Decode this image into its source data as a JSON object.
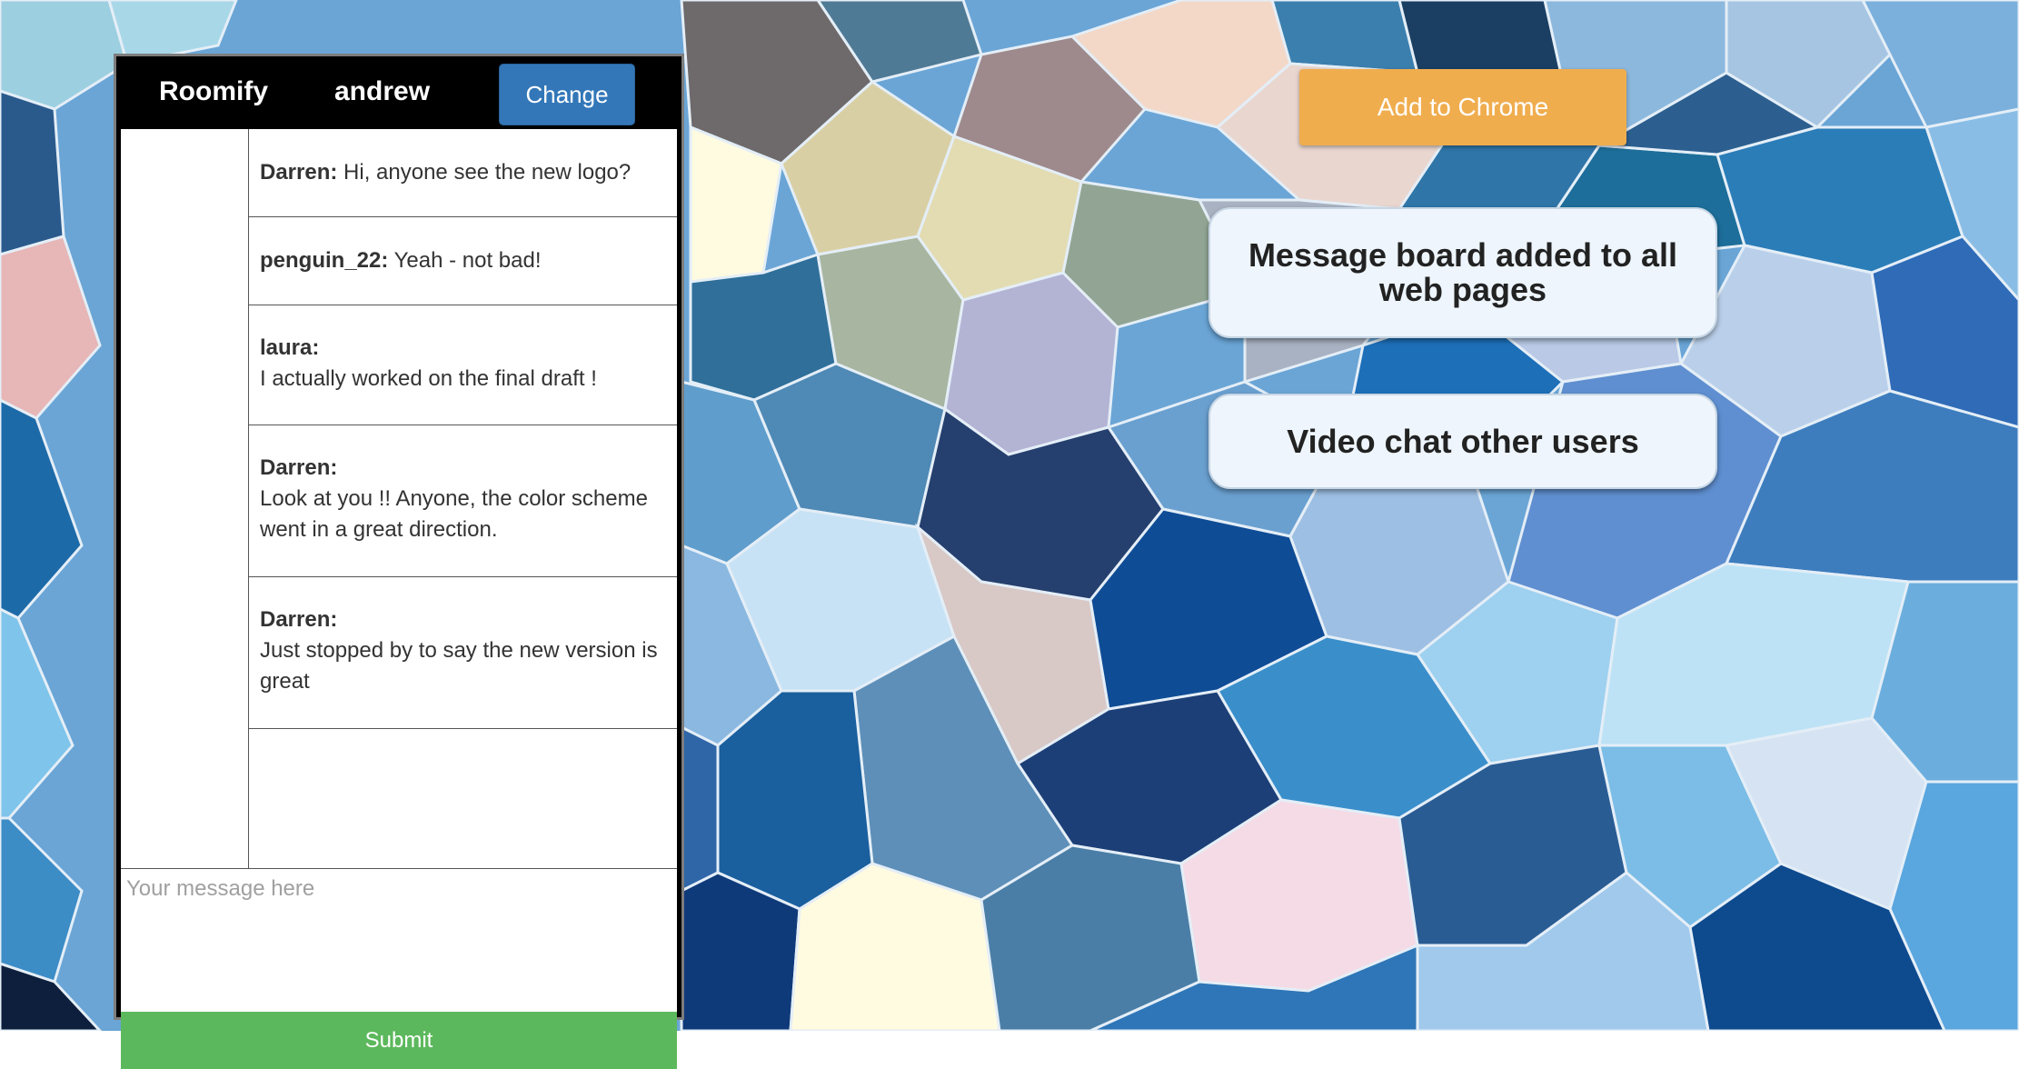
{
  "header": {
    "brand": "Roomify",
    "username": "andrew",
    "change_label": "Change"
  },
  "messages": [
    {
      "author": "Darren:",
      "text": "Hi, anyone see the new logo?"
    },
    {
      "author": "penguin_22:",
      "text": "Yeah - not bad!"
    },
    {
      "author": "laura:",
      "text": "I actually worked on the final draft !"
    },
    {
      "author": "Darren:",
      "text": "Look at you !! Anyone, the color scheme went in a great direction."
    },
    {
      "author": "Darren:",
      "text": "Just stopped by to say the new version is great"
    }
  ],
  "composer": {
    "placeholder": "Your message here",
    "submit_label": "Submit"
  },
  "promo": {
    "add_to_chrome_label": "Add to Chrome",
    "features": [
      "Message board added to all web pages",
      "Video chat other users"
    ]
  },
  "colors": {
    "header_bg": "#000000",
    "change_button": "#3377b8",
    "submit_button": "#5cb85c",
    "chrome_button": "#f0ad4e",
    "feature_card_bg": "#eef5fd"
  }
}
